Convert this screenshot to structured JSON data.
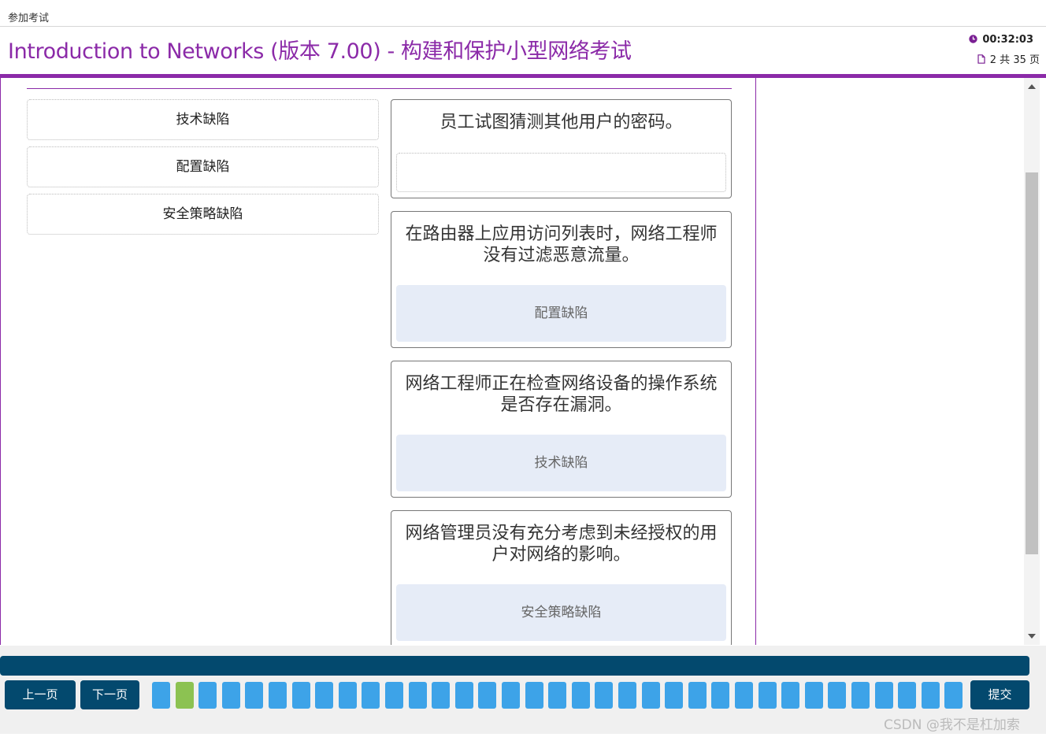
{
  "topbar": {
    "breadcrumb": "参加考试"
  },
  "header": {
    "title": "Introduction to Networks (版本 7.00) - 构建和保护小型网络考试",
    "timer": "00:32:03",
    "page_indicator": "2 共 35 页"
  },
  "options": [
    {
      "label": "技术缺陷"
    },
    {
      "label": "配置缺陷"
    },
    {
      "label": "安全策略缺陷"
    }
  ],
  "cards": [
    {
      "question": "员工试图猜测其他用户的密码。",
      "answer": ""
    },
    {
      "question": "在路由器上应用访问列表时，网络工程师没有过滤恶意流量。",
      "answer": "配置缺陷"
    },
    {
      "question": "网络工程师正在检查网络设备的操作系统是否存在漏洞。",
      "answer": "技术缺陷"
    },
    {
      "question": "网络管理员没有充分考虑到未经授权的用户对网络的影响。",
      "answer": "安全策略缺陷"
    }
  ],
  "footer": {
    "prev_label": "上一页",
    "next_label": "下一页",
    "submit_label": "提交",
    "watermark": "CSDN @我不是杠加索",
    "total_questions": 35,
    "current_question": 2
  },
  "colors": {
    "brand_purple": "#8b2aa8",
    "nav_dark_blue": "#03496e",
    "question_blue": "#3da3e8",
    "question_current_green": "#8cc252",
    "drop_fill": "#e6ecf7"
  },
  "icons": {
    "timer": "clock-icon",
    "pages": "document-icon"
  }
}
